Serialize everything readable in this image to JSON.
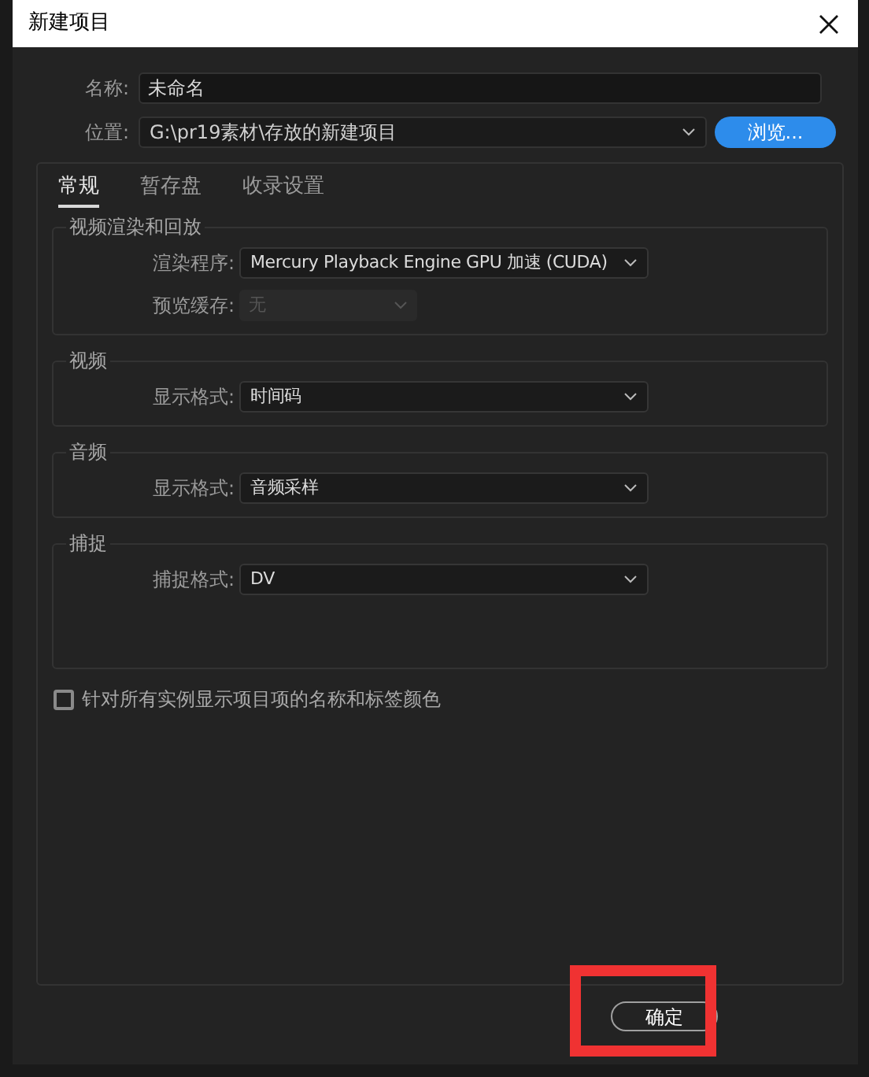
{
  "window": {
    "title": "新建项目"
  },
  "name_field": {
    "label": "名称:",
    "value": "未命名"
  },
  "location_field": {
    "label": "位置:",
    "value": "G:\\pr19素材\\存放的新建项目"
  },
  "browse_button": {
    "label": "浏览..."
  },
  "tabs": [
    {
      "label": "常规",
      "selected": true
    },
    {
      "label": "暂存盘",
      "selected": false
    },
    {
      "label": "收录设置",
      "selected": false
    }
  ],
  "groups": [
    {
      "title": "视频渲染和回放",
      "tall": false,
      "rows": [
        {
          "label": "渲染程序:",
          "value": "Mercury Playback Engine GPU 加速 (CUDA)",
          "disabled": false
        },
        {
          "label": "预览缓存:",
          "value": "无",
          "disabled": true
        }
      ]
    },
    {
      "title": "视频",
      "tall": false,
      "rows": [
        {
          "label": "显示格式:",
          "value": "时间码",
          "disabled": false
        }
      ]
    },
    {
      "title": "音频",
      "tall": false,
      "rows": [
        {
          "label": "显示格式:",
          "value": "音频采样",
          "disabled": false
        }
      ]
    },
    {
      "title": "捕捉",
      "tall": true,
      "rows": [
        {
          "label": "捕捉格式:",
          "value": "DV",
          "disabled": false
        }
      ]
    }
  ],
  "checkbox": {
    "label": "针对所有实例显示项目项的名称和标签颜色",
    "checked": false
  },
  "ok_button": {
    "label": "确定"
  }
}
